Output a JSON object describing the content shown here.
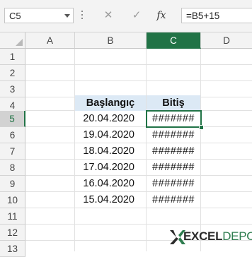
{
  "formula_bar": {
    "name_box": "C5",
    "cancel_icon": "✕",
    "enter_icon": "✓",
    "fx_label": "fx",
    "formula": "=B5+15"
  },
  "columns": [
    "A",
    "B",
    "C",
    "D"
  ],
  "selected_column": "C",
  "rows": [
    "1",
    "2",
    "3",
    "4",
    "5",
    "6",
    "7",
    "8",
    "9",
    "10",
    "11",
    "12",
    "13"
  ],
  "selected_row": "5",
  "active_cell": "C5",
  "table": {
    "headers": [
      "Başlangıç",
      "Bitiş"
    ],
    "rows": [
      [
        "20.04.2020",
        "#######"
      ],
      [
        "19.04.2020",
        "#######"
      ],
      [
        "18.04.2020",
        "#######"
      ],
      [
        "17.04.2020",
        "#######"
      ],
      [
        "16.04.2020",
        "#######"
      ],
      [
        "15.04.2020",
        "#######"
      ]
    ]
  },
  "logo": {
    "part1": "EXCEL",
    "part2": "DEPO"
  },
  "colors": {
    "accent": "#217346",
    "header_fill": "#dce9f5",
    "logo_green": "#2e7d4f"
  }
}
